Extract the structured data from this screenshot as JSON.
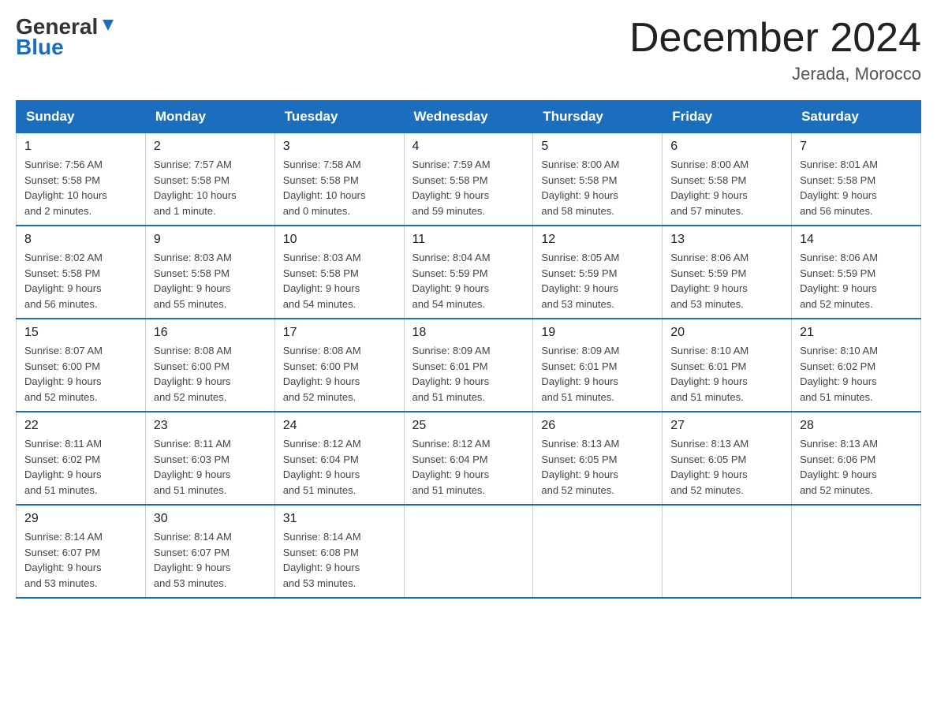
{
  "header": {
    "logo_general": "General",
    "logo_blue": "Blue",
    "month_title": "December 2024",
    "location": "Jerada, Morocco"
  },
  "days_of_week": [
    "Sunday",
    "Monday",
    "Tuesday",
    "Wednesday",
    "Thursday",
    "Friday",
    "Saturday"
  ],
  "weeks": [
    [
      {
        "day": "1",
        "sunrise": "7:56 AM",
        "sunset": "5:58 PM",
        "daylight": "10 hours and 2 minutes."
      },
      {
        "day": "2",
        "sunrise": "7:57 AM",
        "sunset": "5:58 PM",
        "daylight": "10 hours and 1 minute."
      },
      {
        "day": "3",
        "sunrise": "7:58 AM",
        "sunset": "5:58 PM",
        "daylight": "10 hours and 0 minutes."
      },
      {
        "day": "4",
        "sunrise": "7:59 AM",
        "sunset": "5:58 PM",
        "daylight": "9 hours and 59 minutes."
      },
      {
        "day": "5",
        "sunrise": "8:00 AM",
        "sunset": "5:58 PM",
        "daylight": "9 hours and 58 minutes."
      },
      {
        "day": "6",
        "sunrise": "8:00 AM",
        "sunset": "5:58 PM",
        "daylight": "9 hours and 57 minutes."
      },
      {
        "day": "7",
        "sunrise": "8:01 AM",
        "sunset": "5:58 PM",
        "daylight": "9 hours and 56 minutes."
      }
    ],
    [
      {
        "day": "8",
        "sunrise": "8:02 AM",
        "sunset": "5:58 PM",
        "daylight": "9 hours and 56 minutes."
      },
      {
        "day": "9",
        "sunrise": "8:03 AM",
        "sunset": "5:58 PM",
        "daylight": "9 hours and 55 minutes."
      },
      {
        "day": "10",
        "sunrise": "8:03 AM",
        "sunset": "5:58 PM",
        "daylight": "9 hours and 54 minutes."
      },
      {
        "day": "11",
        "sunrise": "8:04 AM",
        "sunset": "5:59 PM",
        "daylight": "9 hours and 54 minutes."
      },
      {
        "day": "12",
        "sunrise": "8:05 AM",
        "sunset": "5:59 PM",
        "daylight": "9 hours and 53 minutes."
      },
      {
        "day": "13",
        "sunrise": "8:06 AM",
        "sunset": "5:59 PM",
        "daylight": "9 hours and 53 minutes."
      },
      {
        "day": "14",
        "sunrise": "8:06 AM",
        "sunset": "5:59 PM",
        "daylight": "9 hours and 52 minutes."
      }
    ],
    [
      {
        "day": "15",
        "sunrise": "8:07 AM",
        "sunset": "6:00 PM",
        "daylight": "9 hours and 52 minutes."
      },
      {
        "day": "16",
        "sunrise": "8:08 AM",
        "sunset": "6:00 PM",
        "daylight": "9 hours and 52 minutes."
      },
      {
        "day": "17",
        "sunrise": "8:08 AM",
        "sunset": "6:00 PM",
        "daylight": "9 hours and 52 minutes."
      },
      {
        "day": "18",
        "sunrise": "8:09 AM",
        "sunset": "6:01 PM",
        "daylight": "9 hours and 51 minutes."
      },
      {
        "day": "19",
        "sunrise": "8:09 AM",
        "sunset": "6:01 PM",
        "daylight": "9 hours and 51 minutes."
      },
      {
        "day": "20",
        "sunrise": "8:10 AM",
        "sunset": "6:01 PM",
        "daylight": "9 hours and 51 minutes."
      },
      {
        "day": "21",
        "sunrise": "8:10 AM",
        "sunset": "6:02 PM",
        "daylight": "9 hours and 51 minutes."
      }
    ],
    [
      {
        "day": "22",
        "sunrise": "8:11 AM",
        "sunset": "6:02 PM",
        "daylight": "9 hours and 51 minutes."
      },
      {
        "day": "23",
        "sunrise": "8:11 AM",
        "sunset": "6:03 PM",
        "daylight": "9 hours and 51 minutes."
      },
      {
        "day": "24",
        "sunrise": "8:12 AM",
        "sunset": "6:04 PM",
        "daylight": "9 hours and 51 minutes."
      },
      {
        "day": "25",
        "sunrise": "8:12 AM",
        "sunset": "6:04 PM",
        "daylight": "9 hours and 51 minutes."
      },
      {
        "day": "26",
        "sunrise": "8:13 AM",
        "sunset": "6:05 PM",
        "daylight": "9 hours and 52 minutes."
      },
      {
        "day": "27",
        "sunrise": "8:13 AM",
        "sunset": "6:05 PM",
        "daylight": "9 hours and 52 minutes."
      },
      {
        "day": "28",
        "sunrise": "8:13 AM",
        "sunset": "6:06 PM",
        "daylight": "9 hours and 52 minutes."
      }
    ],
    [
      {
        "day": "29",
        "sunrise": "8:14 AM",
        "sunset": "6:07 PM",
        "daylight": "9 hours and 53 minutes."
      },
      {
        "day": "30",
        "sunrise": "8:14 AM",
        "sunset": "6:07 PM",
        "daylight": "9 hours and 53 minutes."
      },
      {
        "day": "31",
        "sunrise": "8:14 AM",
        "sunset": "6:08 PM",
        "daylight": "9 hours and 53 minutes."
      },
      null,
      null,
      null,
      null
    ]
  ],
  "labels": {
    "sunrise": "Sunrise:",
    "sunset": "Sunset:",
    "daylight": "Daylight:"
  }
}
